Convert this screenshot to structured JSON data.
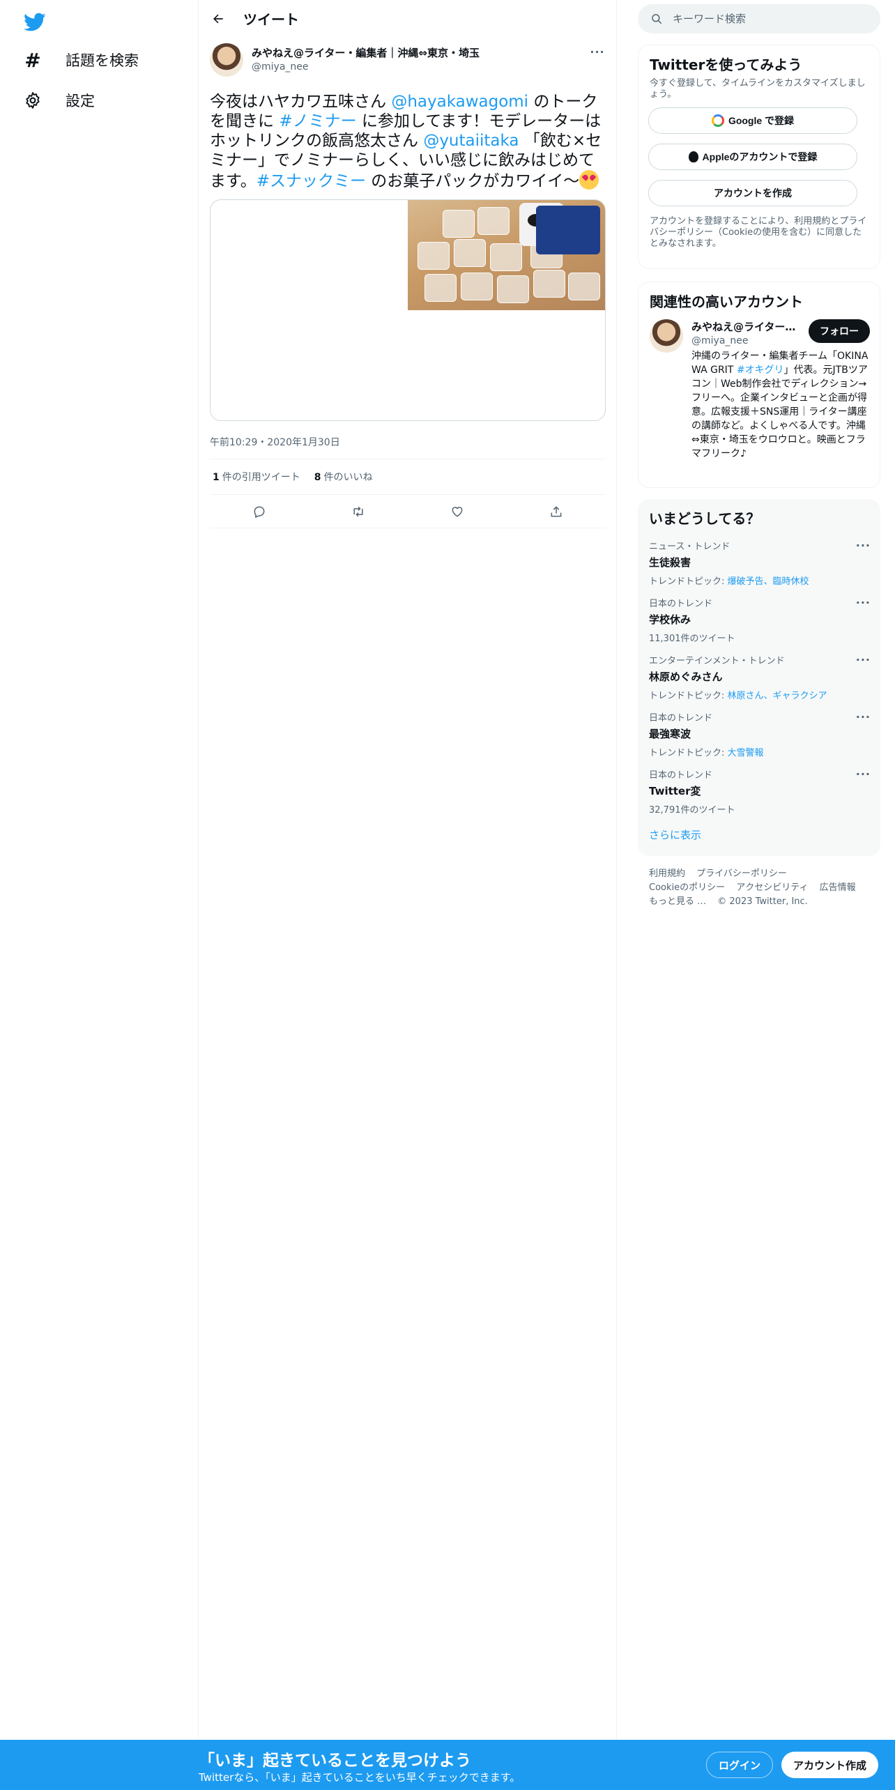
{
  "nav": {
    "items": [
      {
        "icon": "hashtag-icon",
        "label": "話題を検索"
      },
      {
        "icon": "gear-icon",
        "label": "設定"
      }
    ]
  },
  "header": {
    "title": "ツイート"
  },
  "tweet": {
    "display_name": "みやねえ@ライター・編集者｜沖縄⇔東京・埼玉",
    "handle": "@miya_nee",
    "text_parts": [
      {
        "t": "今夜はハヤカワ五味さん "
      },
      {
        "t": "@hayakawagomi",
        "link": true
      },
      {
        "t": " のトークを聞きに "
      },
      {
        "t": "#ノミナー",
        "link": true
      },
      {
        "t": " に参加してます！モデレーターはホットリンクの飯高悠太さん "
      },
      {
        "t": "@yutaiitaka",
        "link": true
      },
      {
        "t": " 「飲む×セミナー」でノミナーらしく、いい感じに飲みはじめてます。"
      },
      {
        "t": "#スナックミー",
        "link": true
      },
      {
        "t": " のお菓子パックがカワイイ〜"
      }
    ],
    "emoji": "smiling-face-with-heart-eyes",
    "timestamp": "午前10:29・2020年1月30日",
    "quote_count": "1",
    "quote_label": "件の引用ツイート",
    "like_count": "8",
    "like_label": "件のいいね"
  },
  "search": {
    "placeholder": "キーワード検索"
  },
  "signup_card": {
    "title": "Twitterを使ってみよう",
    "subtitle": "今すぐ登録して、タイムラインをカスタマイズしましょう。",
    "google_btn": "Google で登録",
    "apple_btn": "Appleのアカウントで登録",
    "create_btn": "アカウントを作成",
    "terms_parts": [
      {
        "t": "アカウントを登録することにより、"
      },
      {
        "t": "利用規約",
        "link": true
      },
      {
        "t": "と"
      },
      {
        "t": "プライバシーポリシー",
        "link": true
      },
      {
        "t": "（"
      },
      {
        "t": "Cookieの使用",
        "link": true
      },
      {
        "t": "を含む）に同意したとみなされます。"
      }
    ]
  },
  "related": {
    "title": "関連性の高いアカウント",
    "name": "みやねえ@ライター・編集者｜沖縄⇔東京・埼玉",
    "handle": "@miya_nee",
    "follow": "フォロー",
    "bio_parts": [
      {
        "t": "沖縄のライター・編集者チーム「OKINAWA GRIT "
      },
      {
        "t": "#オキグリ",
        "link": true
      },
      {
        "t": "」代表。元JTBツアコン｜Web制作会社でディレクション→フリーへ。企業インタビューと企画が得意。広報支援＋SNS運用｜ライター講座の講師など。よくしゃべる人です。沖縄⇔東京・埼玉をウロウロと。映画とフラマフリーク♪"
      }
    ]
  },
  "trends": {
    "title": "いまどうしてる？",
    "items": [
      {
        "category": "ニュース・トレンド",
        "name": "生徒殺害",
        "sub_prefix": "トレンドトピック: ",
        "sub_links": "爆破予告、臨時休校"
      },
      {
        "category": "日本のトレンド",
        "name": "学校休み",
        "sub_prefix": "11,301件のツイート",
        "sub_links": ""
      },
      {
        "category": "エンターテインメント・トレンド",
        "name": "林原めぐみさん",
        "sub_prefix": "トレンドトピック: ",
        "sub_links": "林原さん、ギャラクシア"
      },
      {
        "category": "日本のトレンド",
        "name": "最強寒波",
        "sub_prefix": "トレンドトピック: ",
        "sub_links": "大雪警報"
      },
      {
        "category": "日本のトレンド",
        "name": "Twitter変",
        "sub_prefix": "32,791件のツイート",
        "sub_links": ""
      }
    ],
    "show_more": "さらに表示"
  },
  "footer": {
    "links": [
      "利用規約",
      "プライバシーポリシー",
      "Cookieのポリシー",
      "アクセシビリティ",
      "広告情報",
      "もっと見る …",
      "© 2023 Twitter, Inc."
    ]
  },
  "banner": {
    "title": "「いま」起きていることを見つけよう",
    "subtitle": "Twitterなら、「いま」起きていることをいち早くチェックできます。",
    "login": "ログイン",
    "signup": "アカウント作成"
  },
  "colors": {
    "accent": "#1d9bf0",
    "text": "#0f1419",
    "muted": "#536471"
  }
}
